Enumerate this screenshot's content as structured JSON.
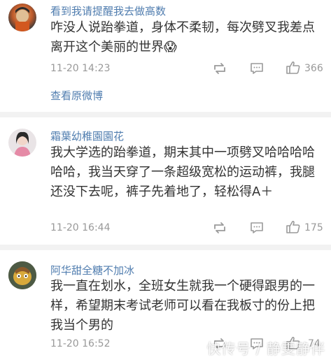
{
  "comments": [
    {
      "username": "看到我请提醒我去做高数",
      "text": "咋没人说跆拳道，身体不柔韧，每次劈叉我差点离开这个美丽的世界😱",
      "time": "11-20 14:23",
      "likes": "366",
      "view_original": "查看原微博"
    },
    {
      "username": "霜葉幼稚園園花",
      "text": "我大学选的跆拳道，期末其中一项劈叉哈哈哈哈哈哈，我当天穿了一条超级宽松的运动裤，我腿还没下去呢，裤子先着地了，轻松得A＋",
      "time": "11-20 16:44",
      "likes": "175"
    },
    {
      "username": "阿华甜全糖不加冰",
      "text": "我一直在划水，全班女生就我一个硬得跟男的一样，希望期末考试老师可以看在我板寸的份上把我当个男的",
      "time": "11-20 16:52",
      "likes": "74"
    }
  ],
  "icons": {
    "repost": "repost-icon",
    "comment": "comment-icon",
    "like": "thumbs-up-icon"
  },
  "watermark": "快传号 / 静雯静伴",
  "colors": {
    "username": "#507daf",
    "body_text": "#333333",
    "meta": "#999999",
    "separator": "#f2f2f2"
  }
}
